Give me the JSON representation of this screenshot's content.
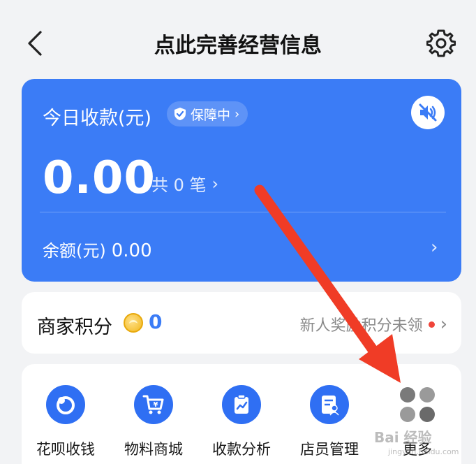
{
  "header": {
    "title": "点此完善经营信息",
    "back_icon": "chevron-left-icon",
    "settings_icon": "gear-icon"
  },
  "pay_card": {
    "title": "今日收款(元)",
    "guard_badge": "保障中",
    "amount": "0.00",
    "count_text": "共 0 笔",
    "balance_label": "余额(元)",
    "balance_value": "0.00",
    "sound_icon": "speaker-muted-icon",
    "color": "#3b7cf6"
  },
  "points": {
    "label": "商家积分",
    "value": "0",
    "reward_text": "新人奖励积分未领"
  },
  "tools": [
    {
      "label": "花呗收钱",
      "icon": "huabei-icon"
    },
    {
      "label": "物料商城",
      "icon": "cart-icon"
    },
    {
      "label": "收款分析",
      "icon": "chart-clipboard-icon"
    },
    {
      "label": "店员管理",
      "icon": "staff-card-icon"
    },
    {
      "label": "更多",
      "icon": "more-grid-icon"
    }
  ],
  "watermark": {
    "text": "Bai 经验",
    "sub": "jingyan.baidu.com"
  }
}
